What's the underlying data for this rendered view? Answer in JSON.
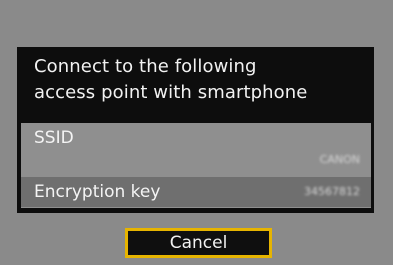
{
  "dialog": {
    "message_line1": "Connect to the following",
    "message_line2": "access point with smartphone"
  },
  "network": {
    "ssid_label": "SSID",
    "ssid_value": "CANON",
    "encryption_label": "Encryption key",
    "encryption_value": "34567812"
  },
  "actions": {
    "cancel_label": "Cancel"
  },
  "colors": {
    "background": "#8a8a8a",
    "dialog": "#0d0d0d",
    "panel": "#8f8f8f",
    "encryption_row": "#6f6f6f",
    "focus_border": "#e6b400"
  }
}
